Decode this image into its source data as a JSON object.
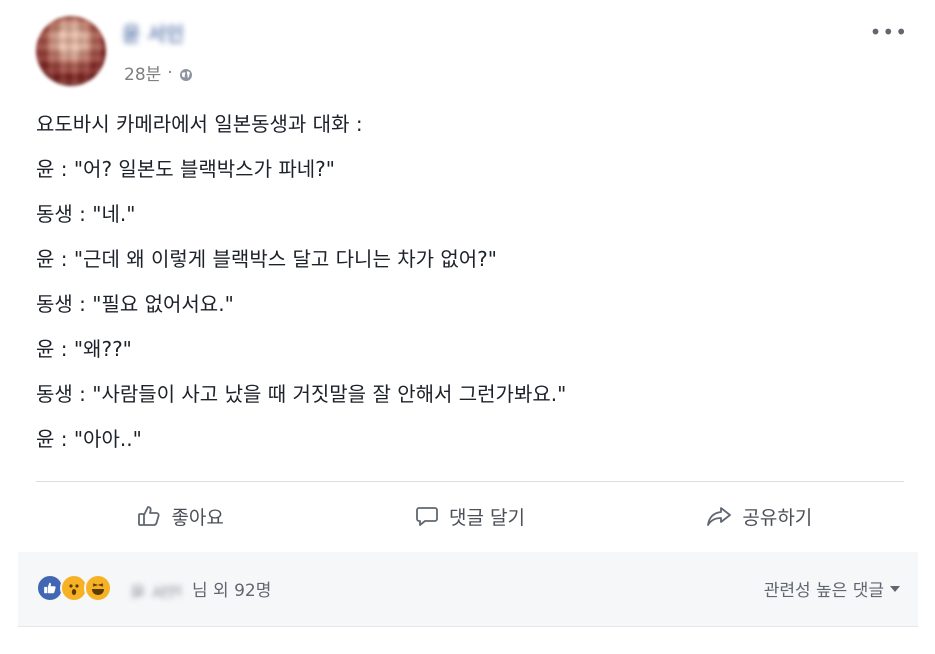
{
  "post": {
    "author_name": "윤 서인",
    "timestamp": "28분",
    "separator": "·",
    "privacy_icon": "globe-icon",
    "more_icon": "•••",
    "lines": [
      "요도바시 카메라에서 일본동생과 대화 :",
      "윤 : \"어? 일본도 블랙박스가 파네?\"",
      "동생 : \"네.\"",
      "윤 : \"근데 왜 이렇게 블랙박스 달고 다니는 차가 없어?\"",
      "동생 : \"필요 없어서요.\"",
      "윤 : \"왜??\"",
      "동생 : \"사람들이 사고 났을 때 거짓말을 잘 안해서 그런가봐요.\"",
      "윤 : \"아아..\""
    ]
  },
  "actions": {
    "like_label": "좋아요",
    "comment_label": "댓글 달기",
    "share_label": "공유하기"
  },
  "footer": {
    "reactor_name": "윤 서인",
    "reactor_suffix": "님 외 92명",
    "sort_label": "관련성 높은 댓글"
  },
  "colors": {
    "link": "#365899",
    "text": "#1d2129",
    "secondary": "#606770",
    "like_blue": "#4267b2",
    "emoji_yellow": "#f7b125"
  }
}
